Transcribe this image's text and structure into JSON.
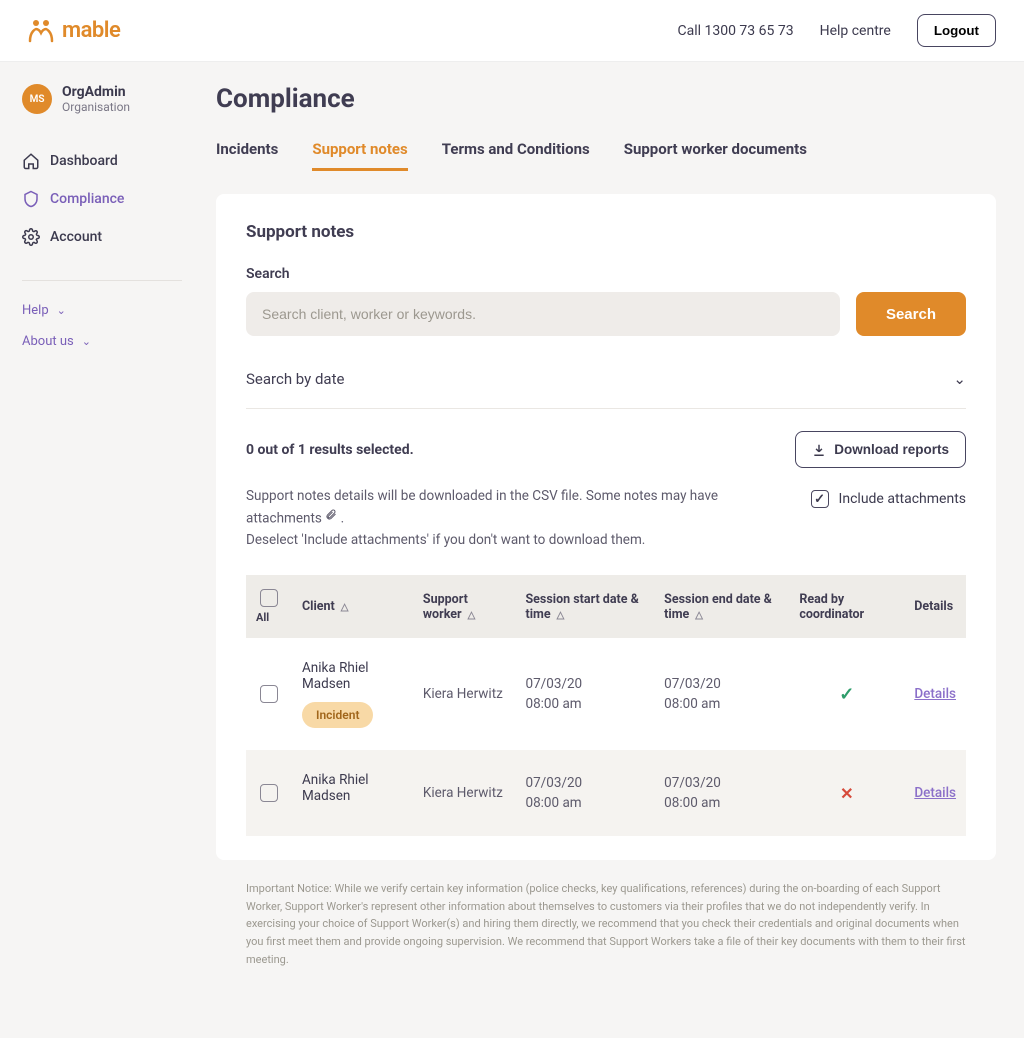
{
  "header": {
    "brand": "mable",
    "phone": "Call 1300 73 65 73",
    "help": "Help centre",
    "logout": "Logout"
  },
  "sidebar": {
    "org_avatar": "MS",
    "org_name": "OrgAdmin",
    "org_sub": "Organisation",
    "items": [
      {
        "label": "Dashboard"
      },
      {
        "label": "Compliance"
      },
      {
        "label": "Account"
      }
    ],
    "help_link": "Help",
    "about_link": "About us"
  },
  "page": {
    "title": "Compliance",
    "tabs": [
      "Incidents",
      "Support notes",
      "Terms and Conditions",
      "Support worker documents"
    ],
    "section_title": "Support notes",
    "search_label": "Search",
    "search_placeholder": "Search client, worker or keywords.",
    "search_btn": "Search",
    "search_by_date": "Search by date",
    "results_selected": "0 out of 1 results selected.",
    "download_btn": "Download reports",
    "note_line1": "Support notes details will be downloaded in the CSV file. Some notes may have attachments",
    "note_line2": "Deselect 'Include attachments' if you don't want to download them.",
    "include_label": "Include attachments"
  },
  "table": {
    "headers": {
      "all": "All",
      "client": "Client",
      "worker": "Support worker",
      "start": "Session start date & time",
      "end": "Session end date & time",
      "read": "Read by coordinator",
      "details": "Details"
    },
    "rows": [
      {
        "client": "Anika Rhiel Madsen",
        "incident": "Incident",
        "worker": "Kiera Herwitz",
        "start_date": "07/03/20",
        "start_time": "08:00 am",
        "end_date": "07/03/20",
        "end_time": "08:00 am",
        "read": true,
        "details": "Details"
      },
      {
        "client": "Anika Rhiel Madsen",
        "incident": "",
        "worker": "Kiera Herwitz",
        "start_date": "07/03/20",
        "start_time": "08:00 am",
        "end_date": "07/03/20",
        "end_time": "08:00 am",
        "read": false,
        "details": "Details"
      }
    ]
  },
  "footer": {
    "text": "Important Notice: While we verify certain key information (police checks, key qualifications, references) during the on-boarding of each Support Worker, Support Worker's represent other information about themselves to customers via their profiles that we do not independently verify. In exercising your choice of Support Worker(s) and hiring them directly, we recommend that you check their credentials and original documents when you first meet them and provide ongoing supervision. We recommend that Support Workers take a file of their key documents with them to their first meeting."
  }
}
